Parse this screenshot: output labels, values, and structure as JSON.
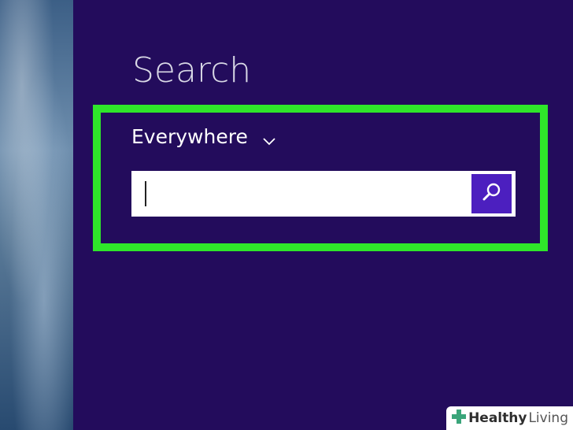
{
  "charm": {
    "title": "Search",
    "scope_label": "Everywhere",
    "search_value": "",
    "search_placeholder": ""
  },
  "icons": {
    "scope_dropdown": "chevron-down-icon",
    "search_button": "search-icon",
    "watermark_logo": "plus-icon"
  },
  "colors": {
    "charm_background": "#230c5c",
    "highlight_border": "#2fe62a",
    "search_button": "#4c1fbf",
    "watermark_logo": "#3aa57a"
  },
  "watermark": {
    "brand_bold": "Healthy",
    "brand_light": "Living"
  }
}
